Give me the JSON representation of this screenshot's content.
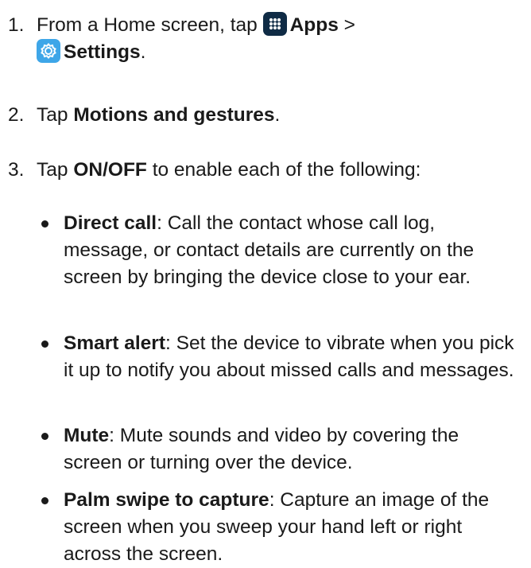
{
  "steps": [
    {
      "number": "1.",
      "intro": "From a Home screen, tap",
      "apps_icon": "apps-grid-icon",
      "apps_label": "Apps",
      "separator": ">",
      "settings_icon": "settings-gear-icon",
      "settings_label": "Settings",
      "end": "."
    },
    {
      "number": "2.",
      "intro": "Tap",
      "bold": "Motions and gestures",
      "end": "."
    },
    {
      "number": "3.",
      "intro": "Tap",
      "bold": "ON/OFF",
      "rest": "to enable each of the following:"
    }
  ],
  "bullets": [
    {
      "term": "Direct call",
      "desc": ": Call the contact whose call log, message, or contact details are currently on the screen by bringing the device close to your ear."
    },
    {
      "term": "Smart alert",
      "desc": ": Set the device to vibrate when you pick it up to notify you about missed calls and messages."
    },
    {
      "term": "Mute",
      "desc": ": Mute sounds and video by covering the screen or turning over the device."
    },
    {
      "term": "Palm swipe to capture",
      "desc": ": Capture an image of the screen when you sweep your hand left or right across the screen."
    }
  ],
  "colors": {
    "text": "#1a1a1a",
    "apps_icon_bg": "#0f2b45",
    "settings_icon_bg": "#3ea6e8"
  }
}
